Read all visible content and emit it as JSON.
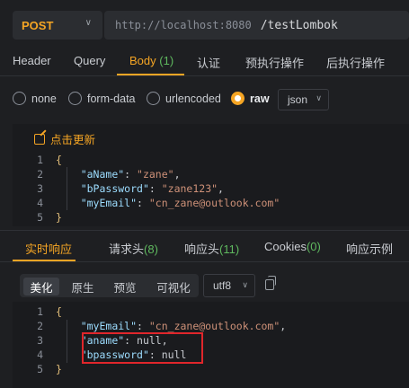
{
  "request": {
    "method": "POST",
    "url_host": "http://localhost:8080",
    "url_path": "/testLombok",
    "tabs": [
      {
        "label": "Header",
        "count": ""
      },
      {
        "label": "Query",
        "count": ""
      },
      {
        "label": "Body",
        "count": "(1)"
      },
      {
        "label": "认证",
        "count": ""
      },
      {
        "label": "预执行操作",
        "count": ""
      },
      {
        "label": "后执行操作",
        "count": ""
      }
    ],
    "active_tab": "Body"
  },
  "body_type": {
    "options": [
      "none",
      "form-data",
      "urlencoded",
      "raw"
    ],
    "selected": "raw",
    "format": "json"
  },
  "editor": {
    "update_label": "点击更新",
    "lines": [
      {
        "n": "1",
        "text": "{"
      },
      {
        "n": "2",
        "key": "\"aName\"",
        "value": "\"zane\"",
        "tail": ","
      },
      {
        "n": "3",
        "key": "\"bPassword\"",
        "value": "\"zane123\"",
        "tail": ","
      },
      {
        "n": "4",
        "key": "\"myEmail\"",
        "value": "\"cn_zane@outlook.com\"",
        "tail": ""
      },
      {
        "n": "5",
        "text": "}"
      }
    ]
  },
  "response": {
    "tabs": [
      {
        "label": "实时响应",
        "count": ""
      },
      {
        "label": "请求头",
        "count": "(8)"
      },
      {
        "label": "响应头",
        "count": "(11)"
      },
      {
        "label": "Cookies",
        "count": "(0)"
      },
      {
        "label": "响应示例",
        "count": ""
      }
    ],
    "active_tab": "实时响应",
    "view_modes": [
      "美化",
      "原生",
      "预览",
      "可视化"
    ],
    "active_view": "美化",
    "encoding": "utf8",
    "lines": [
      {
        "n": "1",
        "text": "{"
      },
      {
        "n": "2",
        "key": "\"myEmail\"",
        "value": "\"cn_zane@outlook.com\"",
        "tail": ","
      },
      {
        "n": "3",
        "key": "\"aname\"",
        "value": "null",
        "tail": ","
      },
      {
        "n": "4",
        "key": "\"bpassword\"",
        "value": "null",
        "tail": ""
      },
      {
        "n": "5",
        "text": "}"
      }
    ]
  },
  "colors": {
    "accent": "#f5a524",
    "highlight": "#e0262b",
    "count": "#5fb95f"
  }
}
